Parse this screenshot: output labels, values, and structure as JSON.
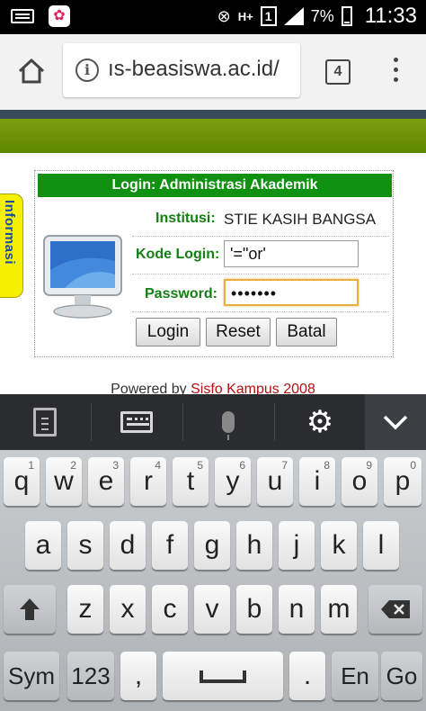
{
  "status_bar": {
    "battery": "7%",
    "time": "11:33",
    "sim_slot": "1",
    "network": "H+"
  },
  "browser": {
    "url": "ıs-beasiswa.ac.id/",
    "tab_count": "4"
  },
  "page": {
    "side_tab": "Informasi",
    "login_title": "Login: Administrasi Akademik",
    "institusi_label": "Institusi:",
    "institusi_value": "STIE KASIH BANGSA",
    "kode_label": "Kode Login:",
    "kode_value": "'=\"or'",
    "password_label": "Password:",
    "password_value": "•••••••",
    "buttons": {
      "login": "Login",
      "reset": "Reset",
      "batal": "Batal"
    },
    "powered_text": "Powered by",
    "powered_link": "Sisfo Kampus 2008"
  },
  "keyboard": {
    "row1": [
      {
        "key": "q",
        "sub": "1"
      },
      {
        "key": "w",
        "sub": "2"
      },
      {
        "key": "e",
        "sub": "3"
      },
      {
        "key": "r",
        "sub": "4"
      },
      {
        "key": "t",
        "sub": "5"
      },
      {
        "key": "y",
        "sub": "6"
      },
      {
        "key": "u",
        "sub": "7"
      },
      {
        "key": "i",
        "sub": "8"
      },
      {
        "key": "o",
        "sub": "9"
      },
      {
        "key": "p",
        "sub": "0"
      }
    ],
    "row2": [
      "a",
      "s",
      "d",
      "f",
      "g",
      "h",
      "j",
      "k",
      "l"
    ],
    "row3": [
      "z",
      "x",
      "c",
      "v",
      "b",
      "n",
      "m"
    ],
    "row4": {
      "sym": "Sym",
      "num": "123",
      "comma": ",",
      "period": ".",
      "lang": "En",
      "go": "Go"
    }
  },
  "colors": {
    "header_green": "#119111",
    "label_green": "#128012",
    "info_tab_yellow": "#f4f000",
    "powered_link": "#b31010"
  }
}
